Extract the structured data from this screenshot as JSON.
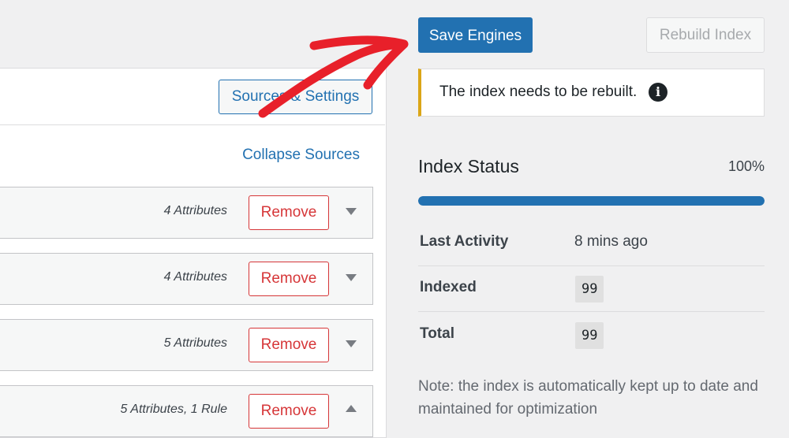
{
  "header": {
    "save_label": "Save Engines",
    "rebuild_label": "Rebuild Index"
  },
  "sources": {
    "settings_label": "Sources & Settings",
    "collapse_label": "Collapse Sources",
    "remove_label": "Remove",
    "rows": [
      {
        "attributes": "4 Attributes",
        "expanded": false
      },
      {
        "attributes": "4 Attributes",
        "expanded": false
      },
      {
        "attributes": "5 Attributes",
        "expanded": false
      },
      {
        "attributes": "5 Attributes, 1 Rule",
        "expanded": true
      }
    ]
  },
  "notice": {
    "text": "The index needs to be rebuilt.",
    "icon": "info-icon"
  },
  "index_status": {
    "title": "Index Status",
    "percent_label": "100%",
    "progress": 1.0,
    "rows": [
      {
        "label": "Last Activity",
        "value": "8 mins ago"
      },
      {
        "label": "Indexed",
        "value": "99"
      },
      {
        "label": "Total",
        "value": "99"
      }
    ],
    "note": "Note: the index is automatically kept up to date and maintained for optimization"
  },
  "colors": {
    "accent": "#2271b1",
    "danger": "#d63638",
    "warning": "#dba617",
    "annotation": "#e8202a"
  }
}
